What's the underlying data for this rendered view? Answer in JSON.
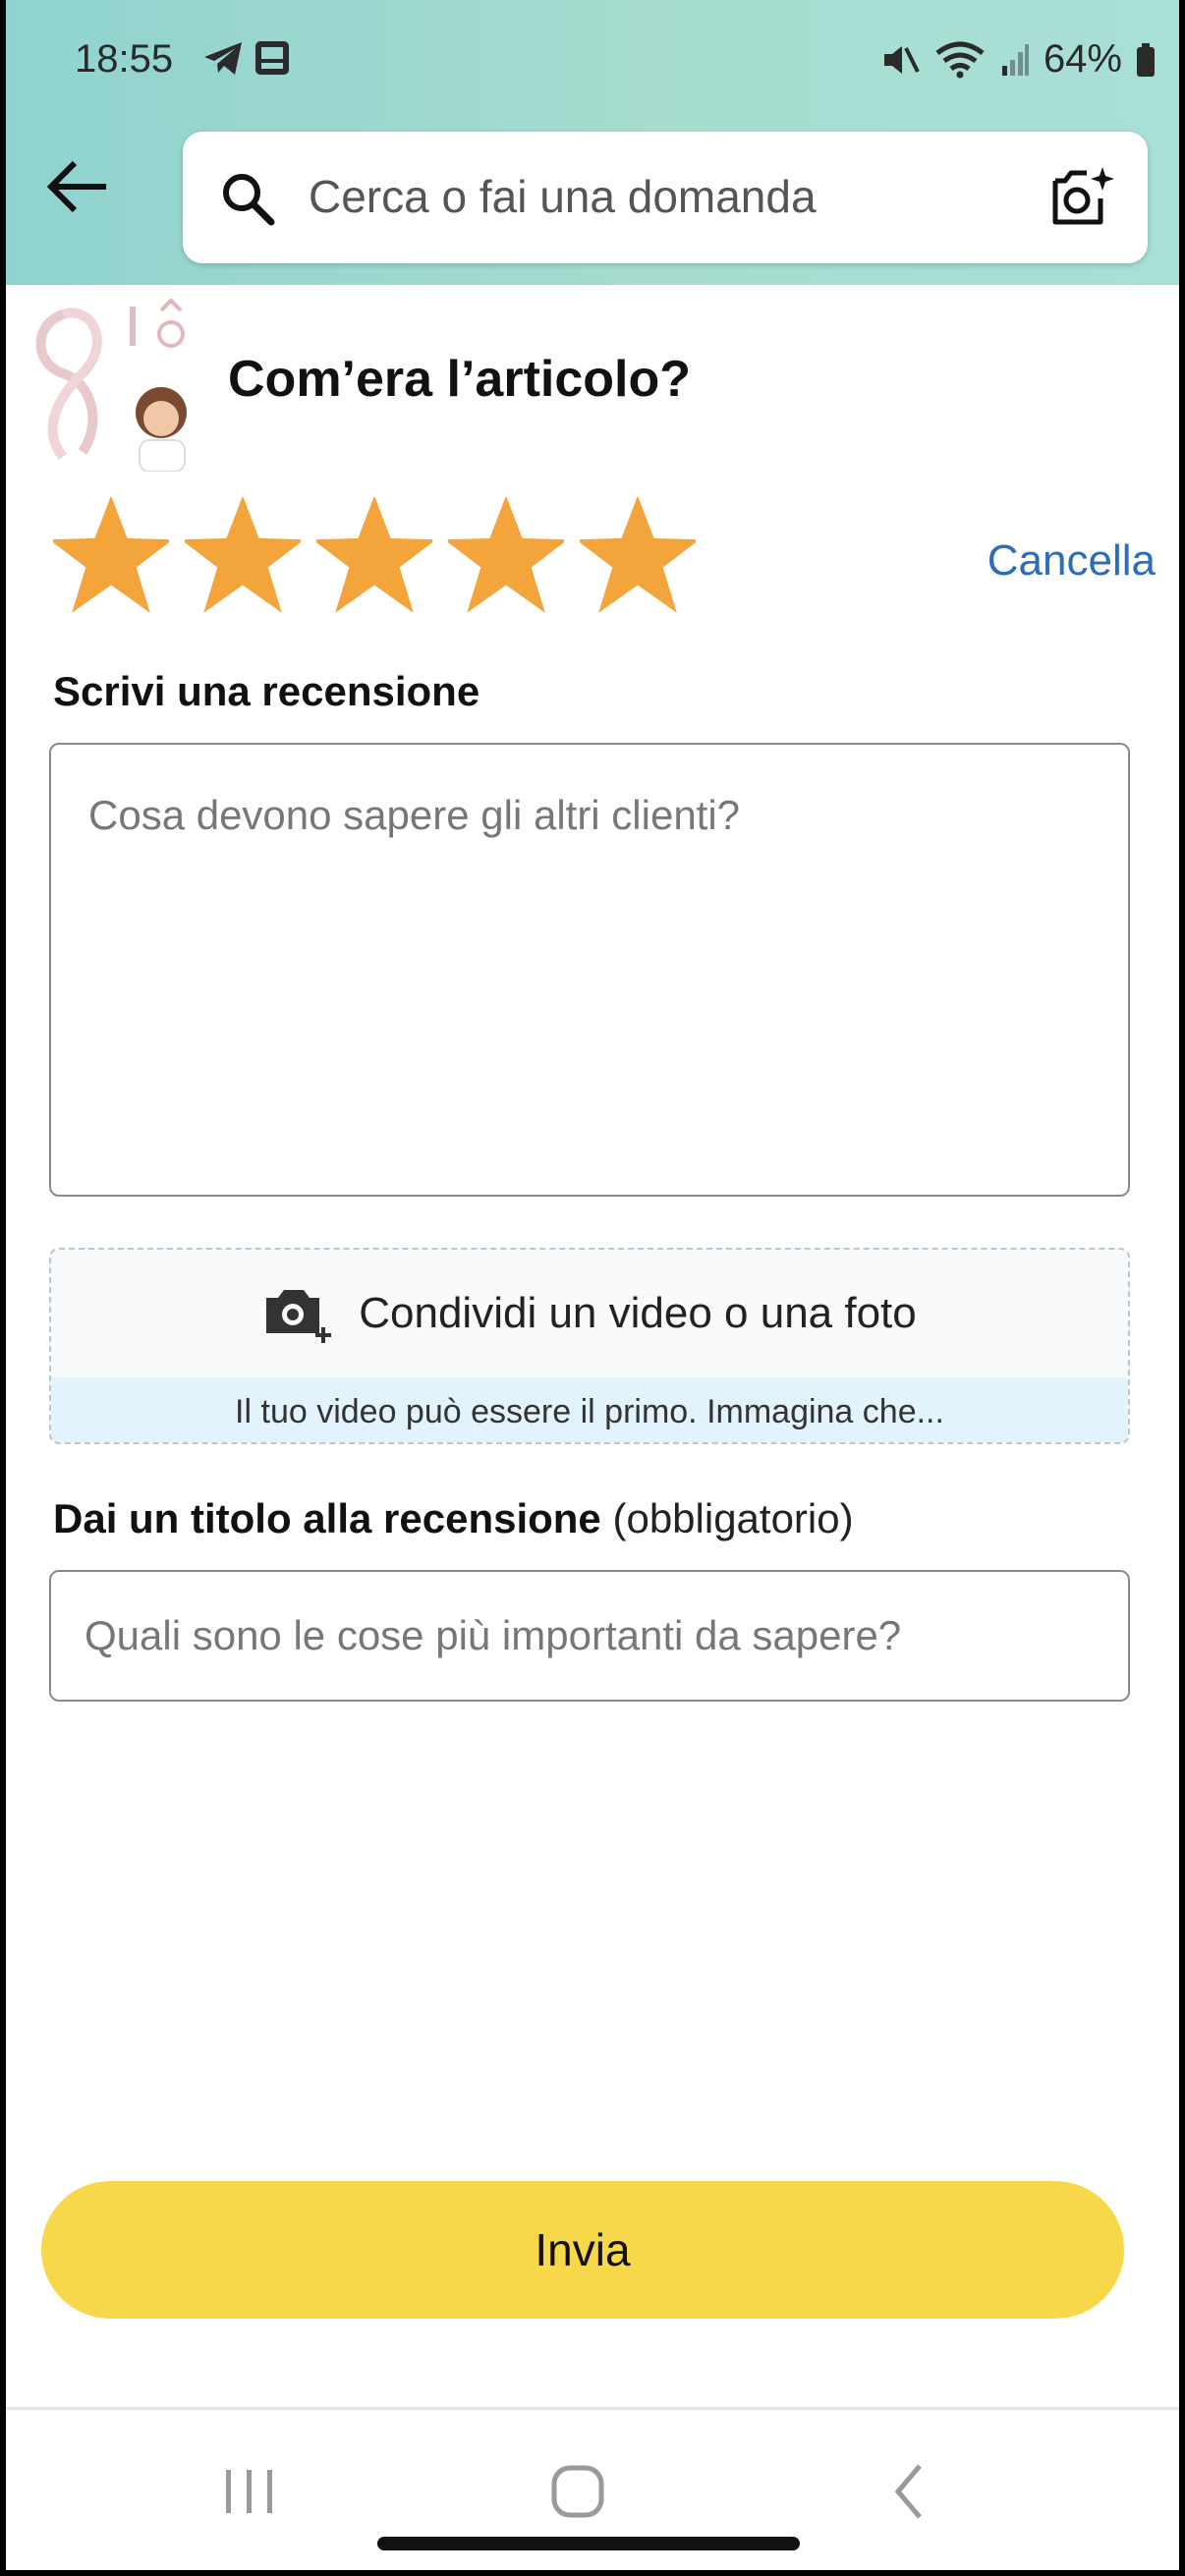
{
  "status_bar": {
    "time": "18:55",
    "battery": "64%",
    "icons": [
      "telegram-icon",
      "gallery-icon",
      "mute-icon",
      "wifi-icon",
      "signal-icon",
      "battery-icon"
    ]
  },
  "header": {
    "search_placeholder": "Cerca o fai una domanda",
    "icons": [
      "back-arrow-icon",
      "search-icon",
      "camera-search-icon"
    ]
  },
  "product": {
    "question": "Com’era l’articolo?"
  },
  "rating": {
    "stars_selected": 5,
    "stars_total": 5,
    "star_color": "#f3a43a",
    "cancel_label": "Cancella"
  },
  "review": {
    "label": "Scrivi una recensione",
    "placeholder": "Cosa devono sapere gli altri clienti?"
  },
  "media": {
    "label": "Condividi un video o una foto",
    "hint": "Il tuo video può essere il primo. Immagina che..."
  },
  "title_field": {
    "label": "Dai un titolo alla recensione",
    "label_suffix": "(obbligatorio)",
    "placeholder": "Quali sono le cose più importanti da sapere?"
  },
  "submit": {
    "label": "Invia",
    "color": "#f7d84a"
  },
  "nav_bar": {
    "icons": [
      "recent-apps-icon",
      "home-icon",
      "back-nav-icon"
    ]
  },
  "colors": {
    "header_gradient_start": "#8fd3cf",
    "header_gradient_end": "#a8dfd7",
    "link": "#2a6ebb"
  }
}
